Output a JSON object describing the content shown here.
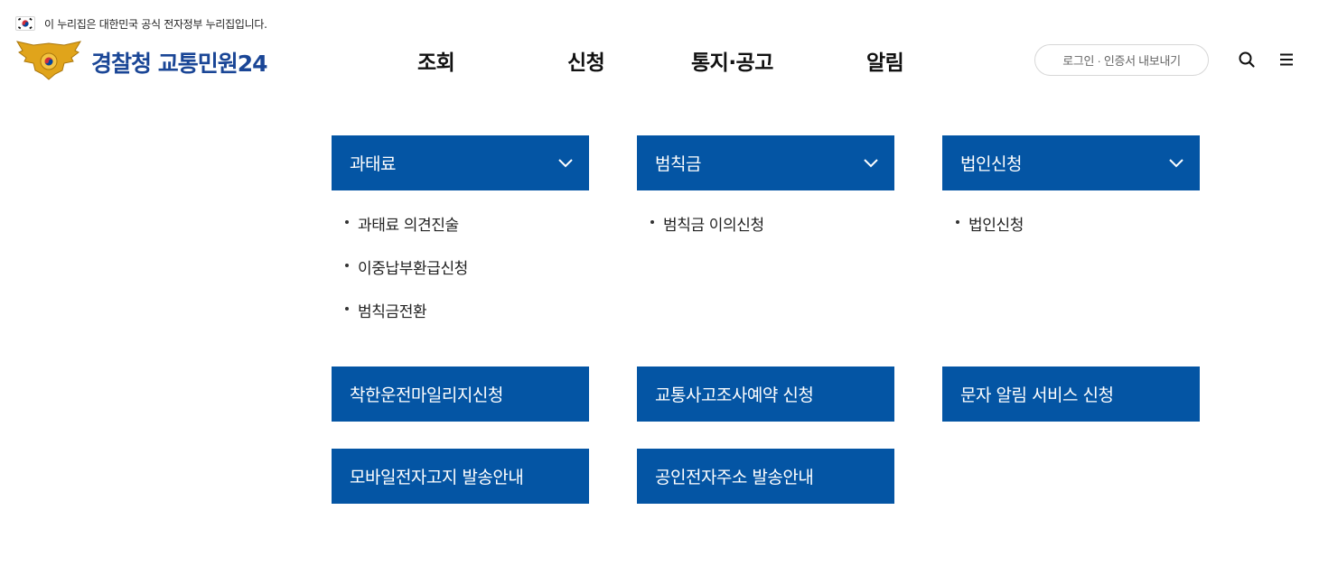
{
  "gov_banner": {
    "text": "이 누리집은 대한민국 공식 전자정부 누리집입니다."
  },
  "logo": {
    "text": "경찰청 교통민원24"
  },
  "gnb": [
    "조회",
    "신청",
    "통지·공고",
    "알림"
  ],
  "header": {
    "login_label": "로그인 · 인증서 내보내기"
  },
  "icons": {
    "search": "search-icon",
    "menu": "hamburger-menu-icon",
    "chevron": "chevron-down-icon"
  },
  "colors": {
    "panel": "#0455a4",
    "brand": "#1a4696"
  },
  "panels": [
    {
      "title": "과태료",
      "items": [
        "과태료 의견진술",
        "이중납부환급신청",
        "범칙금전환"
      ]
    },
    {
      "title": "범칙금",
      "items": [
        "범칙금 이의신청"
      ]
    },
    {
      "title": "법인신청",
      "items": [
        "법인신청"
      ]
    }
  ],
  "services": [
    "착한운전마일리지신청",
    "교통사고조사예약 신청",
    "문자 알림 서비스 신청",
    "모바일전자고지 발송안내",
    "공인전자주소 발송안내"
  ]
}
